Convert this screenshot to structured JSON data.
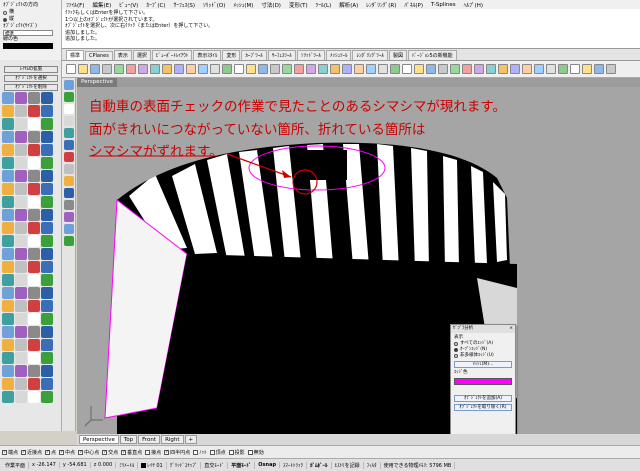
{
  "menubar": [
    "ﾌｧｲﾙ(F)",
    "編集(E)",
    "ﾋﾞｭｰ(V)",
    "ｶｰﾌﾞ(C)",
    "ｻｰﾌｪｽ(S)",
    "ｿﾘｯﾄﾞ(O)",
    "ﾒｯｼｭ(M)",
    "寸法(D)",
    "変形(T)",
    "ﾂｰﾙ(L)",
    "解析(A)",
    "ﾚﾝﾀﾞﾘﾝｸﾞ(R)",
    "ﾊﾟﾈﾙ(P)",
    "T-Splines",
    "ﾍﾙﾌﾟ(H)"
  ],
  "left_panel": {
    "section1": "ｵﾌﾞｼﾞｪｸﾄの方向",
    "radio1": "横",
    "radio2": "縦",
    "section2": "ｵﾌﾞｼﾞｪｸﾄ(ｻｲｽﾞ)",
    "select_value": "標準",
    "color_label": "線の色",
    "button1": "ﾚｲﾔﾑの拡張",
    "button2": "ｵﾌﾞｼﾞｪｸﾄを選択",
    "button3": "ｵﾌﾞｼﾞｪｸﾄを削除"
  },
  "command_history": [
    "ｸﾘｯｸもしくはEnterを押して下さい。",
    "1つ以上のｵﾌﾞｼﾞｪｸﾄが選択されています。",
    "ｵﾌﾞｼﾞｪｸﾄを選択し、次に右ｸﾘｯｸ（またはEnter）を押して下さい。",
    "追加しました。",
    "追加しました。"
  ],
  "tabs": [
    "標準",
    "CPlanes",
    "表示",
    "選択",
    "ﾋﾞｭｰﾎﾟｰﾄﾚｲｱｳﾄ",
    "表示ｽﾀｲﾙ",
    "変形",
    "ｶｰﾌﾞﾂｰﾙ",
    "ｻｰﾌｪｽﾂｰﾙ",
    "ｿﾘｯﾄﾞﾂｰﾙ",
    "ﾒｯｼｭﾂｰﾙ",
    "ﾚﾝﾀﾞﾘﾝｸﾞﾂｰﾙ",
    "製図",
    "ﾊﾞｰｼﾞｮﾝ5の新機能"
  ],
  "viewport": {
    "title": "Perspective",
    "annotation_line1": "自動車の表面チェックの作業で見たことのあるシマシマが現れます。",
    "annotation_line2": "面がきれいにつながっていない箇所、折れている箇所は",
    "annotation_line3": "シマシマがずれます。"
  },
  "dialog": {
    "title": "ｾﾞﾌﾞﾗ分析",
    "close": "×",
    "section_label": "表示",
    "option1": "すべてのｴｯｼﾞ(A)",
    "option2": "ｵｰﾌﾟﾝｴｯｼﾞ(N)",
    "option3": "非多様体ｴｯｼﾞ(U)",
    "button_mesh": "ﾒｯｼｭ(M)...",
    "edge_color_label": "ｴｯｼﾞ色",
    "button_add": "ｵﾌﾞｼﾞｪｸﾄを追加(A)",
    "button_remove": "ｵﾌﾞｼﾞｪｸﾄを取り除く(R)"
  },
  "view_tabs": [
    "Perspective",
    "Top",
    "Front",
    "Right"
  ],
  "osnaps": [
    {
      "label": "端点",
      "checked": true
    },
    {
      "label": "近接点",
      "checked": true
    },
    {
      "label": "点",
      "checked": true
    },
    {
      "label": "中点",
      "checked": true
    },
    {
      "label": "中心点",
      "checked": true
    },
    {
      "label": "交点",
      "checked": true
    },
    {
      "label": "垂直点",
      "checked": true
    },
    {
      "label": "接点",
      "checked": false
    },
    {
      "label": "四半円点",
      "checked": true
    },
    {
      "label": "ﾉｯﾄ",
      "checked": false
    },
    {
      "label": "頂点",
      "checked": false
    },
    {
      "label": "投影",
      "checked": false
    },
    {
      "label": "無効",
      "checked": false
    }
  ],
  "status": {
    "cplane": "作業平面",
    "x": "x -26.147",
    "y": "y -54.681",
    "z": "z 0.000",
    "units": "ﾐﾘﾒｰﾄﾙ",
    "layer": "ﾚｲﾔ 01",
    "grid_snap": "ｸﾞﾘｯﾄﾞｽﾅｯﾌﾟ",
    "ortho": "直交ﾓｰﾄﾞ",
    "planar": "平面ﾓｰﾄﾞ",
    "osnap": "Osnap",
    "smarttrack": "ｽﾏｰﾄﾄﾗｯｸ",
    "gumball": "ｶﾞﾑﾎﾞｰﾙ",
    "history": "ﾋｽﾄﾘを記録",
    "filter": "ﾌｨﾙﾀ",
    "memory": "使用できる物理ﾒﾓﾘ: 5796 MB"
  },
  "colors": {
    "accent_red": "#cc0000",
    "edge_magenta": "#ff00ff",
    "viewport_bg": "#a5a5a5"
  }
}
